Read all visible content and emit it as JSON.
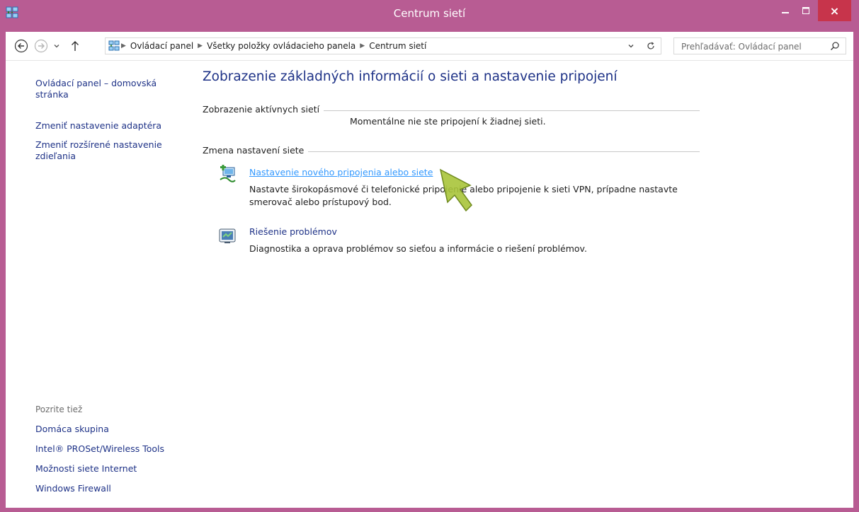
{
  "window": {
    "title": "Centrum sietí",
    "close_label": "×"
  },
  "address": {
    "crumbs": [
      "Ovládací panel",
      "Všetky položky ovládacieho panela",
      "Centrum sietí"
    ],
    "search_placeholder": "Prehľadávať: Ovládací panel"
  },
  "sidebar": {
    "home_link": [
      "Ovládací panel – domovská",
      "stránka"
    ],
    "adapter_link": "Zmeniť nastavenie adaptéra",
    "sharing_link": [
      "Zmeniť rozšírené nastavenie",
      "zdieľania"
    ],
    "see_also_label": "Pozrite tiež",
    "see_also_items": [
      "Domáca skupina",
      "Intel® PROSet/Wireless Tools",
      "Možnosti siete Internet",
      "Windows Firewall"
    ]
  },
  "main": {
    "title": "Zobrazenie základných informácií o sieti a nastavenie pripojení",
    "active_networks_heading": "Zobrazenie aktívnych sietí",
    "no_network_text": "Momentálne nie ste pripojení k žiadnej sieti.",
    "change_settings_heading": "Zmena nastavení siete",
    "tasks": [
      {
        "link": "Nastavenie nového pripojenia alebo siete",
        "desc_line1": "Nastavte širokopásmové či telefonické pripojenie alebo pripojenie k sieti VPN, prípadne nastavte",
        "desc_line2": "smerovač alebo prístupový bod."
      },
      {
        "link": "Riešenie problémov",
        "desc_line1": "Diagnostika a oprava problémov so sieťou a informácie o riešení problémov."
      }
    ]
  },
  "colors": {
    "frame": "#b85c93",
    "close": "#c7344b",
    "link": "#1e3287",
    "link_hover": "#3399ff",
    "cursor": "#a9c43a"
  }
}
